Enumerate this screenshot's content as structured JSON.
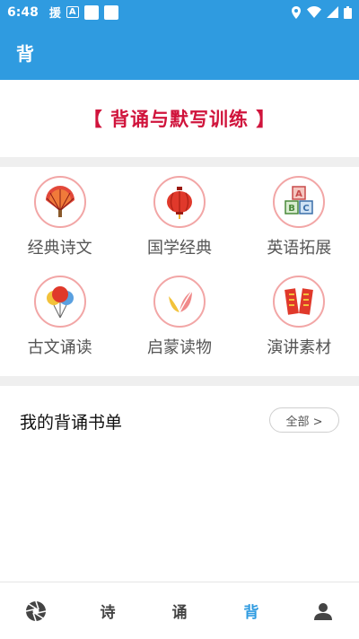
{
  "status_bar": {
    "time": "6:48",
    "glyph_1": "援",
    "glyph_2": "A"
  },
  "header": {
    "title": "背"
  },
  "banner": {
    "text": "【 背诵与默写训练 】"
  },
  "categories": [
    {
      "label": "经典诗文",
      "icon": "fan-icon"
    },
    {
      "label": "国学经典",
      "icon": "lantern-icon"
    },
    {
      "label": "英语拓展",
      "icon": "abc-blocks-icon"
    },
    {
      "label": "古文诵读",
      "icon": "balloons-icon"
    },
    {
      "label": "启蒙读物",
      "icon": "leaves-icon"
    },
    {
      "label": "演讲素材",
      "icon": "couplets-icon"
    }
  ],
  "my_list": {
    "title": "我的背诵书单",
    "all_label": "全部 >"
  },
  "bottom_nav": [
    {
      "label": "",
      "icon": "camera-shutter-icon",
      "active": false
    },
    {
      "label": "诗",
      "active": false
    },
    {
      "label": "诵",
      "active": false
    },
    {
      "label": "背",
      "active": true
    },
    {
      "label": "",
      "icon": "person-icon",
      "active": false
    }
  ],
  "colors": {
    "primary": "#2f9be0",
    "banner_red": "#d0143c",
    "icon_ring": "#f2a6a6"
  }
}
